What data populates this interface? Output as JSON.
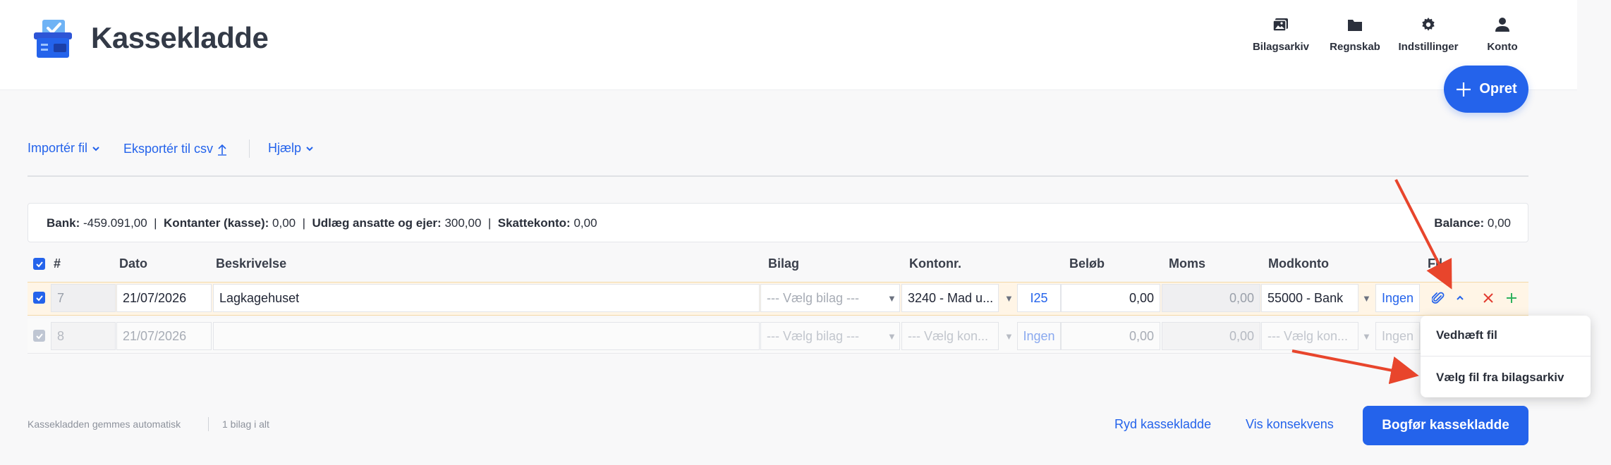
{
  "app": {
    "title": "Kassekladde"
  },
  "nav": [
    {
      "label": "Bilagsarkiv",
      "icon": "photo-album-icon"
    },
    {
      "label": "Regnskab",
      "icon": "folder-icon"
    },
    {
      "label": "Indstillinger",
      "icon": "gear-icon"
    },
    {
      "label": "Konto",
      "icon": "user-icon"
    }
  ],
  "create_button": {
    "label": "Opret"
  },
  "toolbar": {
    "import_label": "Importér fil",
    "export_label": "Eksportér til csv",
    "help_label": "Hjælp"
  },
  "summary": {
    "bank_label": "Bank:",
    "bank_value": "-459.091,00",
    "cash_label": "Kontanter (kasse):",
    "cash_value": "0,00",
    "expense_label": "Udlæg ansatte og ejer:",
    "expense_value": "300,00",
    "tax_label": "Skattekonto:",
    "tax_value": "0,00",
    "balance_label": "Balance:",
    "balance_value": "0,00"
  },
  "table": {
    "headers": {
      "number": "#",
      "date": "Dato",
      "description": "Beskrivelse",
      "voucher": "Bilag",
      "account": "Kontonr.",
      "amount": "Beløb",
      "vat": "Moms",
      "counter_account": "Modkonto",
      "file": "Fil"
    },
    "rows": [
      {
        "number": "7",
        "date": "21/07/2026",
        "description": "Lagkagehuset",
        "voucher": "--- Vælg bilag ---",
        "account": "3240 - Mad u...",
        "vat_code": "I25",
        "amount": "0,00",
        "vat": "0,00",
        "counter_account": "55000 - Bank",
        "counter_vat": "Ingen"
      },
      {
        "number": "8",
        "date": "21/07/2026",
        "description": "",
        "voucher": "--- Vælg bilag ---",
        "account": "--- Vælg kon...",
        "vat_code": "Ingen",
        "amount": "0,00",
        "vat": "0,00",
        "counter_account": "--- Vælg kon...",
        "counter_vat": "Ingen"
      }
    ]
  },
  "file_menu": {
    "attach_label": "Vedhæft fil",
    "archive_label": "Vælg fil fra bilagsarkiv"
  },
  "footer": {
    "autosave": "Kassekladden gemmes automatisk",
    "count": "1 bilag i alt",
    "clear_label": "Ryd kassekladde",
    "consequence_label": "Vis konsekvens",
    "post_label": "Bogfør kassekladde"
  },
  "colors": {
    "accent": "#2463eb",
    "annotation": "#e8452c",
    "row_highlight": "#fff5e6"
  }
}
